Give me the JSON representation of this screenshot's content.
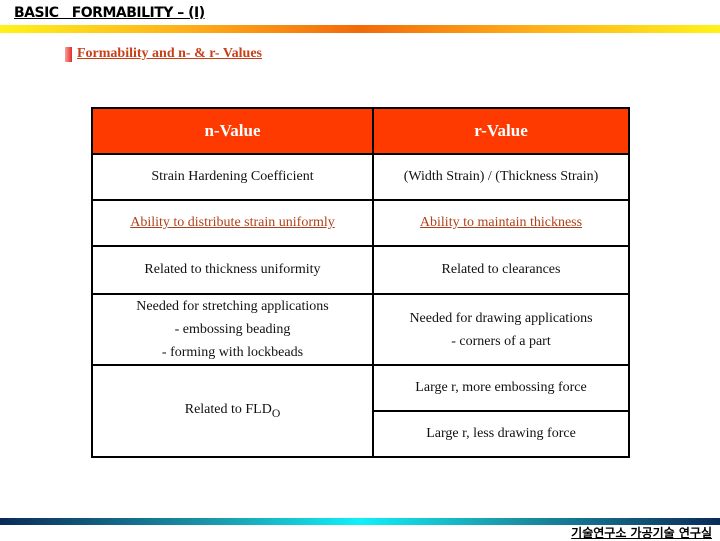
{
  "slide": {
    "title": "BASIC   FORMABILITY – (I)",
    "subtitle": "Formability and n- & r- Values",
    "footer": "기술연구소 가공기술 연구실"
  },
  "colors": {
    "header_bg": "#ff3a00",
    "subtitle_text": "#c8401a",
    "accent_link": "#b0401a"
  },
  "table": {
    "headers": [
      "n-Value",
      "r-Value"
    ],
    "rows": [
      {
        "n": "Strain Hardening Coefficient",
        "r": "(Width Strain) / (Thickness Strain)"
      },
      {
        "n": "Ability to distribute strain uniformly",
        "r": "Ability to maintain thickness"
      },
      {
        "n": "Related to thickness uniformity",
        "r": "Related to clearances"
      },
      {
        "n_lines": [
          "Needed for stretching applications",
          "- embossing beading",
          "- forming with lockbeads"
        ],
        "r_lines": [
          "Needed for drawing applications",
          "- corners of a part"
        ]
      },
      {
        "n_main": "Related to FLD",
        "n_sub": "O",
        "r_lines": [
          "Large r, more embossing force",
          "Large r, less drawing force"
        ]
      }
    ]
  }
}
